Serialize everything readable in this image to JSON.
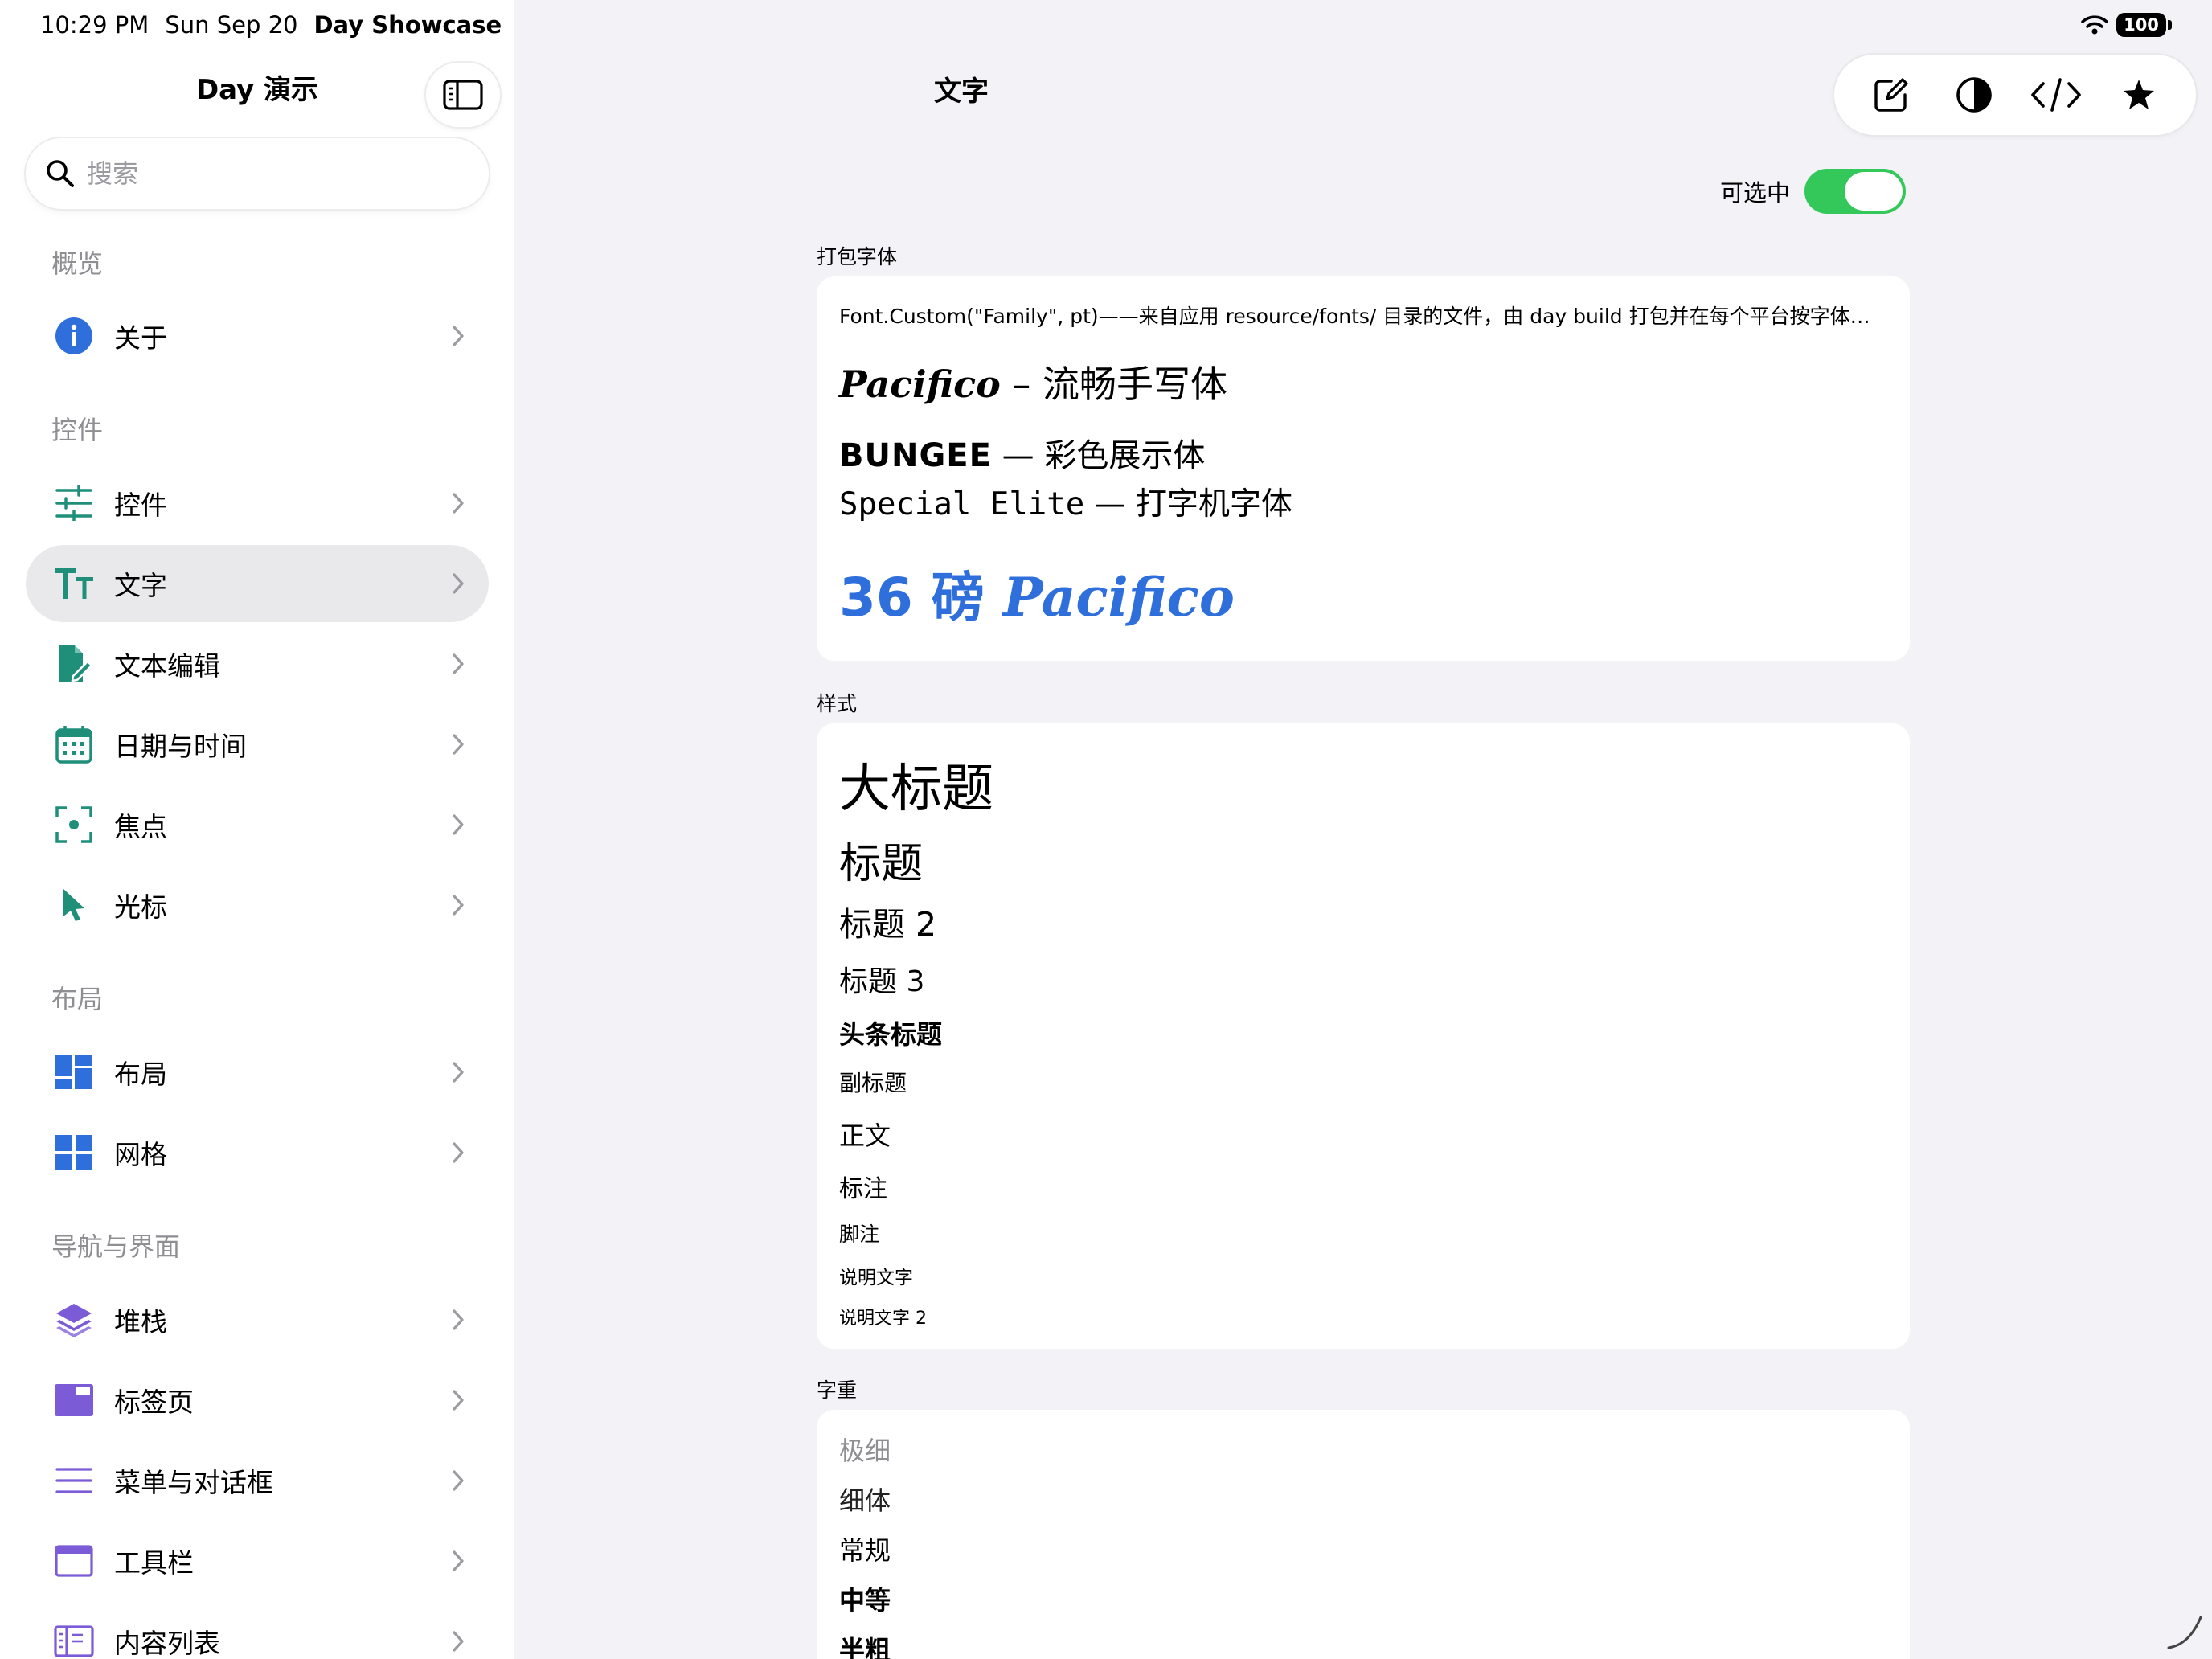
{
  "status": {
    "time": "10:29 PM",
    "date": "Sun Sep 20",
    "app": "Day Showcase",
    "battery": "100"
  },
  "sidebar": {
    "title": "Day 演示",
    "search_placeholder": "搜索",
    "sections": [
      {
        "title": "概览",
        "items": [
          {
            "label": "关于",
            "icon": "info-icon"
          }
        ]
      },
      {
        "title": "控件",
        "items": [
          {
            "label": "控件",
            "icon": "sliders-icon"
          },
          {
            "label": "文字",
            "icon": "text-size-icon",
            "active": true
          },
          {
            "label": "文本编辑",
            "icon": "doc-edit-icon"
          },
          {
            "label": "日期与时间",
            "icon": "calendar-icon"
          },
          {
            "label": "焦点",
            "icon": "focus-icon"
          },
          {
            "label": "光标",
            "icon": "cursor-icon"
          }
        ]
      },
      {
        "title": "布局",
        "items": [
          {
            "label": "布局",
            "icon": "layout-icon"
          },
          {
            "label": "网格",
            "icon": "grid-icon"
          }
        ]
      },
      {
        "title": "导航与界面",
        "items": [
          {
            "label": "堆栈",
            "icon": "stack-icon"
          },
          {
            "label": "标签页",
            "icon": "tabs-icon"
          },
          {
            "label": "菜单与对话框",
            "icon": "menu-icon"
          },
          {
            "label": "工具栏",
            "icon": "toolbar-icon"
          },
          {
            "label": "内容列表",
            "icon": "content-list-icon"
          }
        ]
      }
    ]
  },
  "main": {
    "title": "文字",
    "toolbar": [
      "compose-icon",
      "contrast-icon",
      "code-icon",
      "star-icon"
    ],
    "selectable_label": "可选中",
    "selectable_on": true,
    "bundled": {
      "label": "打包字体",
      "desc": "Font.Custom(\"Family\", pt)——来自应用 resource/fonts/ 目录的文件，由 day build 打包并在每个平台按字体族…",
      "pacifico_name": "Pacifico",
      "pacifico_desc": " – 流畅手写体",
      "bungee_name": "BUNGEE",
      "bungee_desc": " — 彩色展示体",
      "special_name": "Special Elite",
      "special_desc": " — 打字机字体",
      "big_prefix": "36 磅 ",
      "big_name": "Pacifico",
      "accent": "#2f6fdc"
    },
    "styles": {
      "label": "样式",
      "items": [
        "大标题",
        "标题",
        "标题 2",
        "标题 3",
        "头条标题",
        "副标题",
        "正文",
        "标注",
        "脚注",
        "说明文字",
        "说明文字 2"
      ]
    },
    "weights": {
      "label": "字重",
      "items": [
        "极细",
        "细体",
        "常规",
        "中等",
        "半粗"
      ]
    }
  }
}
